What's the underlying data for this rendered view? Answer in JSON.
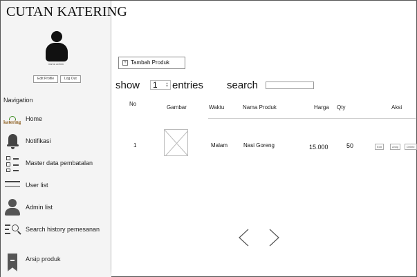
{
  "app": {
    "title": "CUTAN KATERING"
  },
  "profile": {
    "name": "nama admin",
    "edit_label": "Edit Profile",
    "logout_label": "Log Out"
  },
  "navigation": {
    "heading": "Navigation",
    "items": [
      {
        "label": "Home",
        "icon": "katering-logo-icon",
        "logo_text": "katering"
      },
      {
        "label": "Notifikasi",
        "icon": "bell-icon"
      },
      {
        "label": "Master data pembatalan",
        "icon": "checklist-icon"
      },
      {
        "label": "User list",
        "icon": "list-icon"
      },
      {
        "label": "Admin list",
        "icon": "person-icon"
      },
      {
        "label": "Search history pemesanan",
        "icon": "search-list-icon"
      },
      {
        "label": "Arsip produk",
        "icon": "bookmark-icon"
      }
    ]
  },
  "toolbar": {
    "add_product_label": "Tambah Produk"
  },
  "table_controls": {
    "show_label": "show",
    "entries_value": "1",
    "entries_label": "entries",
    "search_label": "search",
    "search_value": ""
  },
  "table": {
    "headers": {
      "no": "No",
      "gambar": "Gambar",
      "waktu": "Waktu",
      "nama": "Nama Produk",
      "harga": "Harga",
      "qty": "Qty",
      "aksi": "Aksi"
    },
    "rows": [
      {
        "no": "1",
        "waktu": "Malam",
        "nama": "Nasi Goreng",
        "harga": "15.000",
        "qty": "50",
        "actions": {
          "edit": "Edit",
          "arsip": "Arsip",
          "delete": "Delete"
        }
      }
    ]
  },
  "pagination": {
    "prev_icon": "chevron-left-icon",
    "next_icon": "chevron-right-icon"
  }
}
